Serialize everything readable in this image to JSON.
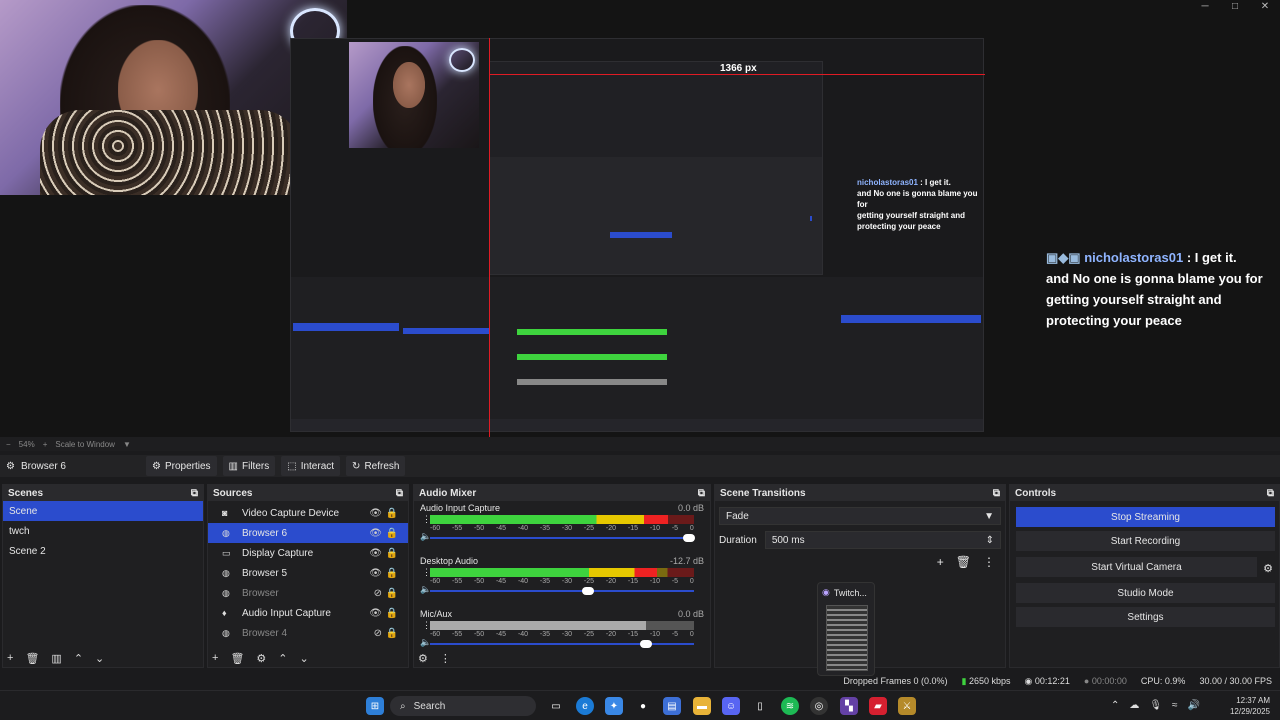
{
  "window": {
    "minimize": "─",
    "maximize": "□",
    "close": "✕"
  },
  "preview": {
    "ruler_label": "1366 px",
    "chat": {
      "user": "nicholastoras01",
      "sep": " : ",
      "lines": [
        "I get it.",
        "and No one is gonna blame you for",
        "getting yourself straight and",
        "protecting your peace"
      ]
    },
    "chat_small": {
      "user": "nicholastoras01",
      "lines": [
        ": I get it.",
        "and No one is gonna blame you for",
        "getting yourself straight and",
        "protecting your peace"
      ]
    }
  },
  "zoom": {
    "level": "54%",
    "mode": "Scale to Window"
  },
  "toolbar": {
    "source_name": "Browser 6",
    "properties": "Properties",
    "filters": "Filters",
    "interact": "Interact",
    "refresh": "Refresh"
  },
  "scenes": {
    "title": "Scenes",
    "items": [
      "Scene",
      "twch",
      "Scene 2"
    ],
    "selected": 0
  },
  "sources": {
    "title": "Sources",
    "items": [
      {
        "name": "Video Capture Device",
        "icon": "camera",
        "visible": true
      },
      {
        "name": "Browser 6",
        "icon": "globe",
        "visible": true,
        "selected": true
      },
      {
        "name": "Display Capture",
        "icon": "monitor",
        "visible": true
      },
      {
        "name": "Browser 5",
        "icon": "globe",
        "visible": true
      },
      {
        "name": "Browser",
        "icon": "globe",
        "visible": false
      },
      {
        "name": "Audio Input Capture",
        "icon": "mic",
        "visible": true
      },
      {
        "name": "Browser 4",
        "icon": "globe",
        "visible": false
      }
    ]
  },
  "mixer": {
    "title": "Audio Mixer",
    "ticks": [
      "-60",
      "-55",
      "-50",
      "-45",
      "-40",
      "-35",
      "-30",
      "-25",
      "-20",
      "-15",
      "-10",
      "-5",
      "0"
    ],
    "channels": [
      {
        "name": "Audio Input Capture",
        "db": "0.0 dB",
        "level": 0.9,
        "fader": 0.98
      },
      {
        "name": "Desktop Audio",
        "db": "-12.7 dB",
        "level": 0.86,
        "fader": 0.6
      },
      {
        "name": "Mic/Aux",
        "db": "0.0 dB",
        "level": 0.82,
        "fader": 0.82
      }
    ]
  },
  "transitions": {
    "title": "Scene Transitions",
    "type": "Fade",
    "duration_label": "Duration",
    "duration": "500 ms"
  },
  "controls": {
    "title": "Controls",
    "buttons": [
      "Stop Streaming",
      "Start Recording",
      "Start Virtual Camera",
      "Studio Mode",
      "Settings"
    ]
  },
  "status": {
    "dropped": "Dropped Frames 0 (0.0%)",
    "bitrate": "2650 kbps",
    "live_time": "00:12:21",
    "rec_time": "00:00:00",
    "cpu": "CPU: 0.9%",
    "fps": "30.00 / 30.00 FPS"
  },
  "taskbar": {
    "search": "Search",
    "time": "12:37 AM",
    "date": "12/29/2025"
  },
  "popup": {
    "title": "Twitch..."
  }
}
